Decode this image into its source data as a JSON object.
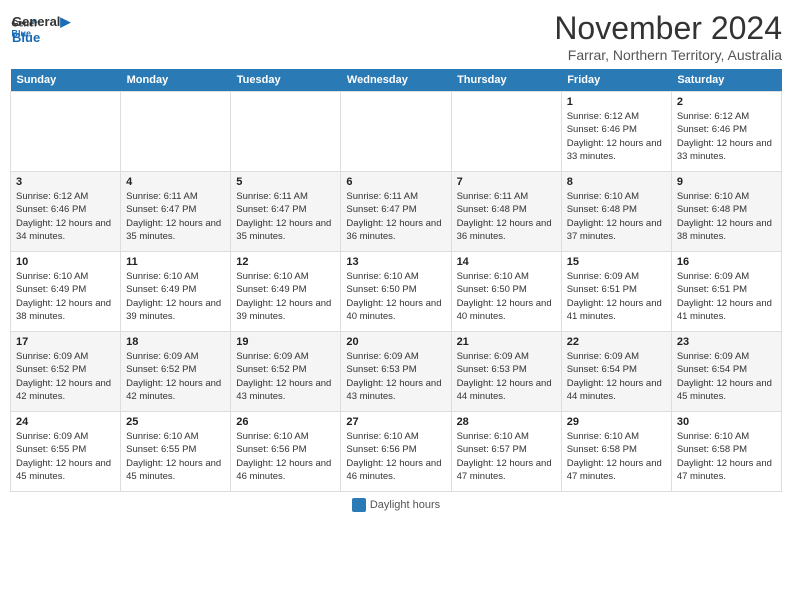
{
  "header": {
    "logo_line1": "General",
    "logo_line2": "Blue",
    "month_title": "November 2024",
    "subtitle": "Farrar, Northern Territory, Australia"
  },
  "days_of_week": [
    "Sunday",
    "Monday",
    "Tuesday",
    "Wednesday",
    "Thursday",
    "Friday",
    "Saturday"
  ],
  "weeks": [
    [
      {
        "day": "",
        "info": ""
      },
      {
        "day": "",
        "info": ""
      },
      {
        "day": "",
        "info": ""
      },
      {
        "day": "",
        "info": ""
      },
      {
        "day": "",
        "info": ""
      },
      {
        "day": "1",
        "info": "Sunrise: 6:12 AM\nSunset: 6:46 PM\nDaylight: 12 hours and 33 minutes."
      },
      {
        "day": "2",
        "info": "Sunrise: 6:12 AM\nSunset: 6:46 PM\nDaylight: 12 hours and 33 minutes."
      }
    ],
    [
      {
        "day": "3",
        "info": "Sunrise: 6:12 AM\nSunset: 6:46 PM\nDaylight: 12 hours and 34 minutes."
      },
      {
        "day": "4",
        "info": "Sunrise: 6:11 AM\nSunset: 6:47 PM\nDaylight: 12 hours and 35 minutes."
      },
      {
        "day": "5",
        "info": "Sunrise: 6:11 AM\nSunset: 6:47 PM\nDaylight: 12 hours and 35 minutes."
      },
      {
        "day": "6",
        "info": "Sunrise: 6:11 AM\nSunset: 6:47 PM\nDaylight: 12 hours and 36 minutes."
      },
      {
        "day": "7",
        "info": "Sunrise: 6:11 AM\nSunset: 6:48 PM\nDaylight: 12 hours and 36 minutes."
      },
      {
        "day": "8",
        "info": "Sunrise: 6:10 AM\nSunset: 6:48 PM\nDaylight: 12 hours and 37 minutes."
      },
      {
        "day": "9",
        "info": "Sunrise: 6:10 AM\nSunset: 6:48 PM\nDaylight: 12 hours and 38 minutes."
      }
    ],
    [
      {
        "day": "10",
        "info": "Sunrise: 6:10 AM\nSunset: 6:49 PM\nDaylight: 12 hours and 38 minutes."
      },
      {
        "day": "11",
        "info": "Sunrise: 6:10 AM\nSunset: 6:49 PM\nDaylight: 12 hours and 39 minutes."
      },
      {
        "day": "12",
        "info": "Sunrise: 6:10 AM\nSunset: 6:49 PM\nDaylight: 12 hours and 39 minutes."
      },
      {
        "day": "13",
        "info": "Sunrise: 6:10 AM\nSunset: 6:50 PM\nDaylight: 12 hours and 40 minutes."
      },
      {
        "day": "14",
        "info": "Sunrise: 6:10 AM\nSunset: 6:50 PM\nDaylight: 12 hours and 40 minutes."
      },
      {
        "day": "15",
        "info": "Sunrise: 6:09 AM\nSunset: 6:51 PM\nDaylight: 12 hours and 41 minutes."
      },
      {
        "day": "16",
        "info": "Sunrise: 6:09 AM\nSunset: 6:51 PM\nDaylight: 12 hours and 41 minutes."
      }
    ],
    [
      {
        "day": "17",
        "info": "Sunrise: 6:09 AM\nSunset: 6:52 PM\nDaylight: 12 hours and 42 minutes."
      },
      {
        "day": "18",
        "info": "Sunrise: 6:09 AM\nSunset: 6:52 PM\nDaylight: 12 hours and 42 minutes."
      },
      {
        "day": "19",
        "info": "Sunrise: 6:09 AM\nSunset: 6:52 PM\nDaylight: 12 hours and 43 minutes."
      },
      {
        "day": "20",
        "info": "Sunrise: 6:09 AM\nSunset: 6:53 PM\nDaylight: 12 hours and 43 minutes."
      },
      {
        "day": "21",
        "info": "Sunrise: 6:09 AM\nSunset: 6:53 PM\nDaylight: 12 hours and 44 minutes."
      },
      {
        "day": "22",
        "info": "Sunrise: 6:09 AM\nSunset: 6:54 PM\nDaylight: 12 hours and 44 minutes."
      },
      {
        "day": "23",
        "info": "Sunrise: 6:09 AM\nSunset: 6:54 PM\nDaylight: 12 hours and 45 minutes."
      }
    ],
    [
      {
        "day": "24",
        "info": "Sunrise: 6:09 AM\nSunset: 6:55 PM\nDaylight: 12 hours and 45 minutes."
      },
      {
        "day": "25",
        "info": "Sunrise: 6:10 AM\nSunset: 6:55 PM\nDaylight: 12 hours and 45 minutes."
      },
      {
        "day": "26",
        "info": "Sunrise: 6:10 AM\nSunset: 6:56 PM\nDaylight: 12 hours and 46 minutes."
      },
      {
        "day": "27",
        "info": "Sunrise: 6:10 AM\nSunset: 6:56 PM\nDaylight: 12 hours and 46 minutes."
      },
      {
        "day": "28",
        "info": "Sunrise: 6:10 AM\nSunset: 6:57 PM\nDaylight: 12 hours and 47 minutes."
      },
      {
        "day": "29",
        "info": "Sunrise: 6:10 AM\nSunset: 6:58 PM\nDaylight: 12 hours and 47 minutes."
      },
      {
        "day": "30",
        "info": "Sunrise: 6:10 AM\nSunset: 6:58 PM\nDaylight: 12 hours and 47 minutes."
      }
    ]
  ],
  "footer": {
    "legend_label": "Daylight hours"
  }
}
